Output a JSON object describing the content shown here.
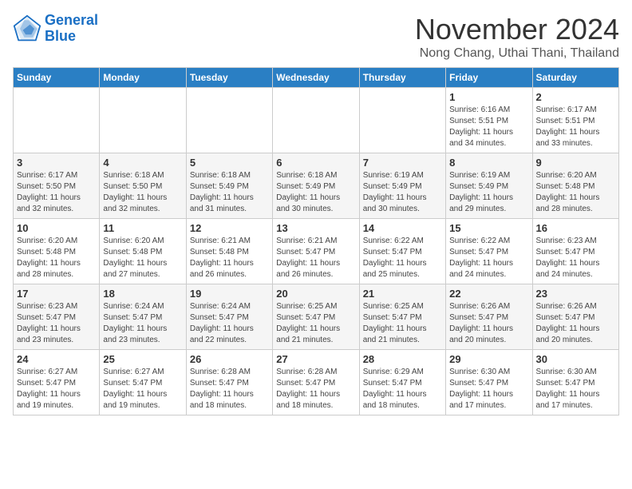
{
  "header": {
    "logo_line1": "General",
    "logo_line2": "Blue",
    "month_title": "November 2024",
    "location": "Nong Chang, Uthai Thani, Thailand"
  },
  "days_of_week": [
    "Sunday",
    "Monday",
    "Tuesday",
    "Wednesday",
    "Thursday",
    "Friday",
    "Saturday"
  ],
  "weeks": [
    [
      {
        "day": "",
        "info": ""
      },
      {
        "day": "",
        "info": ""
      },
      {
        "day": "",
        "info": ""
      },
      {
        "day": "",
        "info": ""
      },
      {
        "day": "",
        "info": ""
      },
      {
        "day": "1",
        "info": "Sunrise: 6:16 AM\nSunset: 5:51 PM\nDaylight: 11 hours\nand 34 minutes."
      },
      {
        "day": "2",
        "info": "Sunrise: 6:17 AM\nSunset: 5:51 PM\nDaylight: 11 hours\nand 33 minutes."
      }
    ],
    [
      {
        "day": "3",
        "info": "Sunrise: 6:17 AM\nSunset: 5:50 PM\nDaylight: 11 hours\nand 32 minutes."
      },
      {
        "day": "4",
        "info": "Sunrise: 6:18 AM\nSunset: 5:50 PM\nDaylight: 11 hours\nand 32 minutes."
      },
      {
        "day": "5",
        "info": "Sunrise: 6:18 AM\nSunset: 5:49 PM\nDaylight: 11 hours\nand 31 minutes."
      },
      {
        "day": "6",
        "info": "Sunrise: 6:18 AM\nSunset: 5:49 PM\nDaylight: 11 hours\nand 30 minutes."
      },
      {
        "day": "7",
        "info": "Sunrise: 6:19 AM\nSunset: 5:49 PM\nDaylight: 11 hours\nand 30 minutes."
      },
      {
        "day": "8",
        "info": "Sunrise: 6:19 AM\nSunset: 5:49 PM\nDaylight: 11 hours\nand 29 minutes."
      },
      {
        "day": "9",
        "info": "Sunrise: 6:20 AM\nSunset: 5:48 PM\nDaylight: 11 hours\nand 28 minutes."
      }
    ],
    [
      {
        "day": "10",
        "info": "Sunrise: 6:20 AM\nSunset: 5:48 PM\nDaylight: 11 hours\nand 28 minutes."
      },
      {
        "day": "11",
        "info": "Sunrise: 6:20 AM\nSunset: 5:48 PM\nDaylight: 11 hours\nand 27 minutes."
      },
      {
        "day": "12",
        "info": "Sunrise: 6:21 AM\nSunset: 5:48 PM\nDaylight: 11 hours\nand 26 minutes."
      },
      {
        "day": "13",
        "info": "Sunrise: 6:21 AM\nSunset: 5:47 PM\nDaylight: 11 hours\nand 26 minutes."
      },
      {
        "day": "14",
        "info": "Sunrise: 6:22 AM\nSunset: 5:47 PM\nDaylight: 11 hours\nand 25 minutes."
      },
      {
        "day": "15",
        "info": "Sunrise: 6:22 AM\nSunset: 5:47 PM\nDaylight: 11 hours\nand 24 minutes."
      },
      {
        "day": "16",
        "info": "Sunrise: 6:23 AM\nSunset: 5:47 PM\nDaylight: 11 hours\nand 24 minutes."
      }
    ],
    [
      {
        "day": "17",
        "info": "Sunrise: 6:23 AM\nSunset: 5:47 PM\nDaylight: 11 hours\nand 23 minutes."
      },
      {
        "day": "18",
        "info": "Sunrise: 6:24 AM\nSunset: 5:47 PM\nDaylight: 11 hours\nand 23 minutes."
      },
      {
        "day": "19",
        "info": "Sunrise: 6:24 AM\nSunset: 5:47 PM\nDaylight: 11 hours\nand 22 minutes."
      },
      {
        "day": "20",
        "info": "Sunrise: 6:25 AM\nSunset: 5:47 PM\nDaylight: 11 hours\nand 21 minutes."
      },
      {
        "day": "21",
        "info": "Sunrise: 6:25 AM\nSunset: 5:47 PM\nDaylight: 11 hours\nand 21 minutes."
      },
      {
        "day": "22",
        "info": "Sunrise: 6:26 AM\nSunset: 5:47 PM\nDaylight: 11 hours\nand 20 minutes."
      },
      {
        "day": "23",
        "info": "Sunrise: 6:26 AM\nSunset: 5:47 PM\nDaylight: 11 hours\nand 20 minutes."
      }
    ],
    [
      {
        "day": "24",
        "info": "Sunrise: 6:27 AM\nSunset: 5:47 PM\nDaylight: 11 hours\nand 19 minutes."
      },
      {
        "day": "25",
        "info": "Sunrise: 6:27 AM\nSunset: 5:47 PM\nDaylight: 11 hours\nand 19 minutes."
      },
      {
        "day": "26",
        "info": "Sunrise: 6:28 AM\nSunset: 5:47 PM\nDaylight: 11 hours\nand 18 minutes."
      },
      {
        "day": "27",
        "info": "Sunrise: 6:28 AM\nSunset: 5:47 PM\nDaylight: 11 hours\nand 18 minutes."
      },
      {
        "day": "28",
        "info": "Sunrise: 6:29 AM\nSunset: 5:47 PM\nDaylight: 11 hours\nand 18 minutes."
      },
      {
        "day": "29",
        "info": "Sunrise: 6:30 AM\nSunset: 5:47 PM\nDaylight: 11 hours\nand 17 minutes."
      },
      {
        "day": "30",
        "info": "Sunrise: 6:30 AM\nSunset: 5:47 PM\nDaylight: 11 hours\nand 17 minutes."
      }
    ]
  ]
}
